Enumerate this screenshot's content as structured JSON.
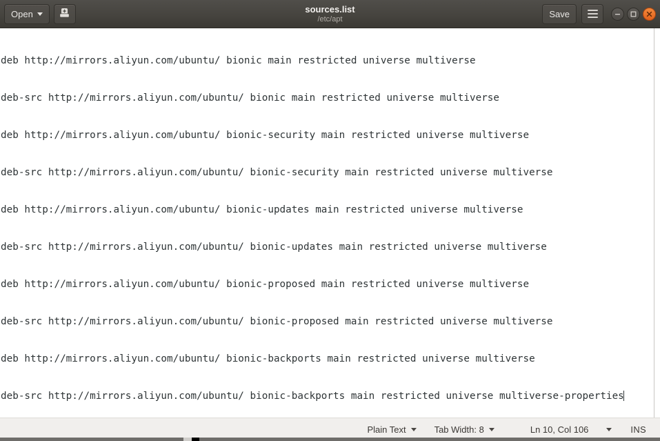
{
  "titlebar": {
    "open_button_label": "Open",
    "new_doc_icon": "new-document-icon",
    "title": "sources.list",
    "subtitle": "/etc/apt",
    "save_button_label": "Save",
    "menu_icon": "hamburger-menu-icon",
    "window_controls": {
      "minimize": "minimize-icon",
      "maximize": "maximize-icon",
      "close": "close-icon"
    },
    "colors": {
      "titlebar_bg": "#46443f",
      "close_button": "#e2611c",
      "title_text": "#f2f0ee",
      "subtitle_text": "#b0aca6"
    }
  },
  "editor": {
    "lines": [
      "deb http://mirrors.aliyun.com/ubuntu/ bionic main restricted universe multiverse",
      "deb-src http://mirrors.aliyun.com/ubuntu/ bionic main restricted universe multiverse",
      "deb http://mirrors.aliyun.com/ubuntu/ bionic-security main restricted universe multiverse",
      "deb-src http://mirrors.aliyun.com/ubuntu/ bionic-security main restricted universe multiverse",
      "deb http://mirrors.aliyun.com/ubuntu/ bionic-updates main restricted universe multiverse",
      "deb-src http://mirrors.aliyun.com/ubuntu/ bionic-updates main restricted universe multiverse",
      "deb http://mirrors.aliyun.com/ubuntu/ bionic-proposed main restricted universe multiverse",
      "deb-src http://mirrors.aliyun.com/ubuntu/ bionic-proposed main restricted universe multiverse",
      "deb http://mirrors.aliyun.com/ubuntu/ bionic-backports main restricted universe multiverse",
      "deb-src http://mirrors.aliyun.com/ubuntu/ bionic-backports main restricted universe multiverse-properties"
    ],
    "text_color": "#2e3436",
    "background": "#ffffff"
  },
  "statusbar": {
    "language_label": "Plain Text",
    "tab_width_label": "Tab Width: 8",
    "position_label": "Ln 10, Col 106",
    "insert_mode_label": "INS",
    "background": "#f1efed"
  }
}
